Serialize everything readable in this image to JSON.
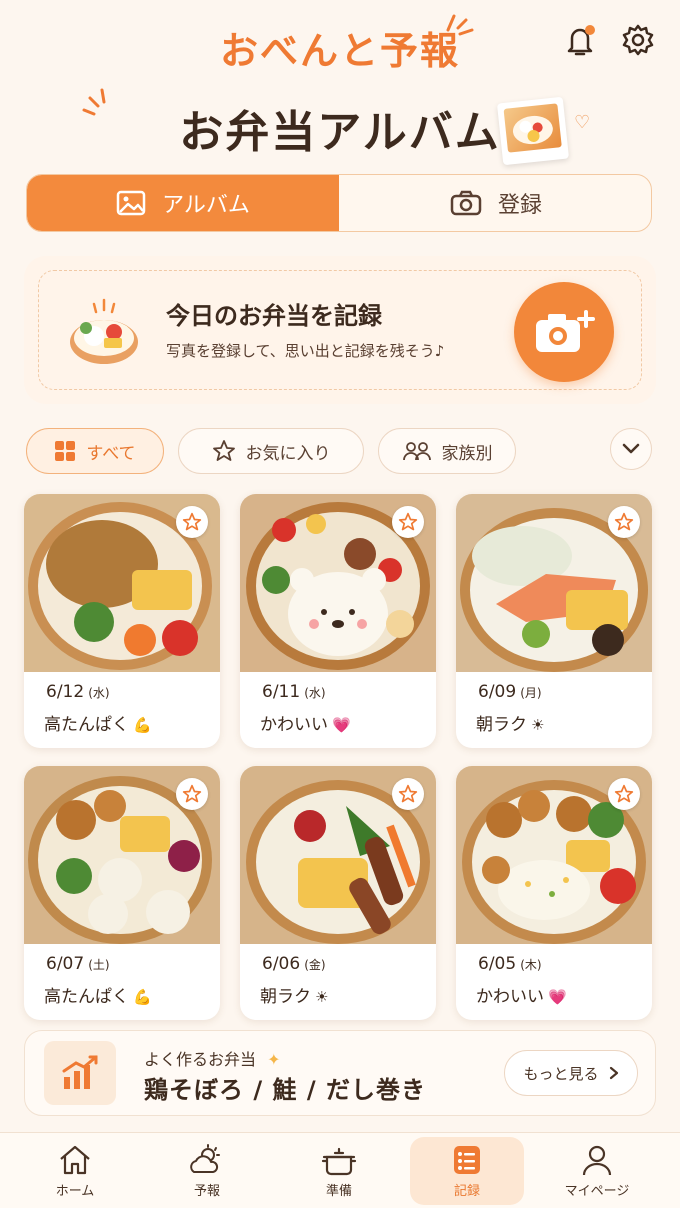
{
  "app": {
    "title": "おべんと予報"
  },
  "page": {
    "title": "お弁当アルバム"
  },
  "segments": [
    {
      "label": "アルバム",
      "icon": "image-icon",
      "active": true
    },
    {
      "label": "登録",
      "icon": "camera-icon",
      "active": false
    }
  ],
  "record_card": {
    "title": "今日のお弁当を記録",
    "subtitle": "写真を登録して、思い出と記録を残そう♪"
  },
  "filters": [
    {
      "label": "すべて",
      "icon": "grid-icon",
      "active": true
    },
    {
      "label": "お気に入り",
      "icon": "star-icon",
      "active": false
    },
    {
      "label": "家族別",
      "icon": "family-icon",
      "active": false
    }
  ],
  "album": [
    {
      "date": "6/12",
      "dow": "(水)",
      "tag": "高たんぱく",
      "emoji": "💪"
    },
    {
      "date": "6/11",
      "dow": "(水)",
      "tag": "かわいい",
      "emoji": "💗"
    },
    {
      "date": "6/09",
      "dow": "(月)",
      "tag": "朝ラク",
      "emoji": "☀"
    },
    {
      "date": "6/07",
      "dow": "(土)",
      "tag": "高たんぱく",
      "emoji": "💪"
    },
    {
      "date": "6/06",
      "dow": "(金)",
      "tag": "朝ラク",
      "emoji": "☀"
    },
    {
      "date": "6/05",
      "dow": "(木)",
      "tag": "かわいい",
      "emoji": "💗"
    }
  ],
  "frequent": {
    "label": "よく作るお弁当",
    "items": "鶏そぼろ / 鮭 / だし巻き",
    "more": "もっと見る"
  },
  "nav": [
    {
      "label": "ホーム",
      "icon": "home-icon"
    },
    {
      "label": "予報",
      "icon": "weather-icon"
    },
    {
      "label": "準備",
      "icon": "pot-icon"
    },
    {
      "label": "記録",
      "icon": "record-icon",
      "active": true
    },
    {
      "label": "マイページ",
      "icon": "user-icon"
    }
  ],
  "colors": {
    "accent": "#f38a3d",
    "background": "#fdf6ef",
    "text": "#3d2a1e"
  }
}
